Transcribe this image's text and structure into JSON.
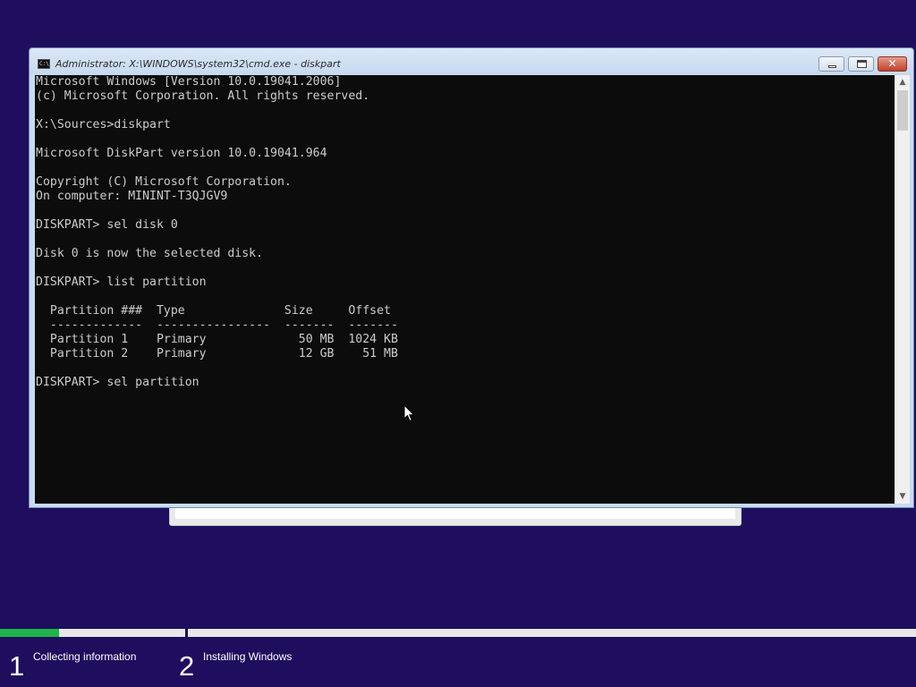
{
  "window": {
    "title": "Administrator: X:\\WINDOWS\\system32\\cmd.exe - diskpart",
    "icon": "cmd-icon",
    "icon_label": "C:\\",
    "close_glyph": "✕"
  },
  "console": {
    "lines": [
      "Microsoft Windows [Version 10.0.19041.2006]",
      "(c) Microsoft Corporation. All rights reserved.",
      "",
      "X:\\Sources>diskpart",
      "",
      "Microsoft DiskPart version 10.0.19041.964",
      "",
      "Copyright (C) Microsoft Corporation.",
      "On computer: MININT-T3QJGV9",
      "",
      "DISKPART> sel disk 0",
      "",
      "Disk 0 is now the selected disk.",
      "",
      "DISKPART> list partition",
      "",
      "  Partition ###  Type              Size     Offset",
      "  -------------  ----------------  -------  -------",
      "  Partition 1    Primary             50 MB  1024 KB",
      "  Partition 2    Primary             12 GB    51 MB",
      "",
      "DISKPART> sel partition"
    ]
  },
  "scrollbar": {
    "up_glyph": "▲",
    "down_glyph": "▼"
  },
  "setup_progress": {
    "step1_fraction": 0.32,
    "colors": {
      "fill": "#1fb34a",
      "track": "#e8e8e8",
      "background": "#1f0d5e"
    },
    "steps": [
      {
        "number": "1",
        "label": "Collecting information"
      },
      {
        "number": "2",
        "label": "Installing Windows"
      }
    ]
  }
}
